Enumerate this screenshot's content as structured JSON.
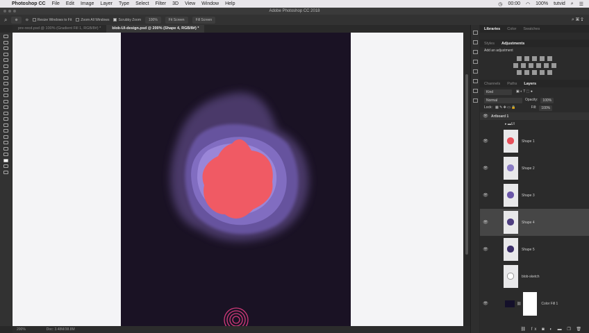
{
  "menubar": {
    "app": "Photoshop CC",
    "items": [
      "File",
      "Edit",
      "Image",
      "Layer",
      "Type",
      "Select",
      "Filter",
      "3D",
      "View",
      "Window",
      "Help"
    ],
    "time": "00:00",
    "battery": "100%",
    "user": "tutvid"
  },
  "window_title": "Adobe Photoshop CC 2018",
  "options": {
    "resize": "Resize Windows to Fit",
    "zoom_all": "Zoom All Windows",
    "scrubby": "Scrubby Zoom",
    "zoom": "100%",
    "fit": "Fit Screen",
    "fill": "Fill Screen"
  },
  "tabs": [
    "pre-recd.psd @ 100% (Gradient Fill 1, RGB/8#) *",
    "blob-UI-design.psd @ 200% (Shape 4, RGB/8#) *"
  ],
  "status": {
    "zoom": "200%",
    "doc": "Doc: 3.48M/38.8M"
  },
  "panels": {
    "top_tabs": [
      "Libraries",
      "Color",
      "Swatches"
    ],
    "mid_tabs": [
      "Styles",
      "Adjustments"
    ],
    "add_adjustment": "Add an adjustment",
    "layer_tabs": [
      "Channels",
      "Paths",
      "Layers"
    ],
    "kind": "Kind",
    "blend": "Normal",
    "opacity_label": "Opacity:",
    "opacity": "100%",
    "lock": "Lock:",
    "fill_label": "Fill:",
    "fill": "100%"
  },
  "layers": {
    "artboard": "Artboard 1",
    "group": "UI",
    "items": [
      {
        "name": "Shape 1",
        "color": "#e8505b",
        "selected": false,
        "eye": "👁"
      },
      {
        "name": "Shape 2",
        "color": "#8a7cc4",
        "selected": false,
        "eye": "👁"
      },
      {
        "name": "Shape 3",
        "color": "#6a56a8",
        "selected": false,
        "eye": "👁"
      },
      {
        "name": "Shape 4",
        "color": "#4e3e80",
        "selected": true,
        "eye": "👁"
      },
      {
        "name": "Shape 5",
        "color": "#3c2f6a",
        "selected": false,
        "eye": "👁"
      },
      {
        "name": "blob-sketch",
        "color": "#ffffff",
        "selected": false,
        "eye": ""
      }
    ],
    "fill_layer": "Color Fill 1"
  }
}
